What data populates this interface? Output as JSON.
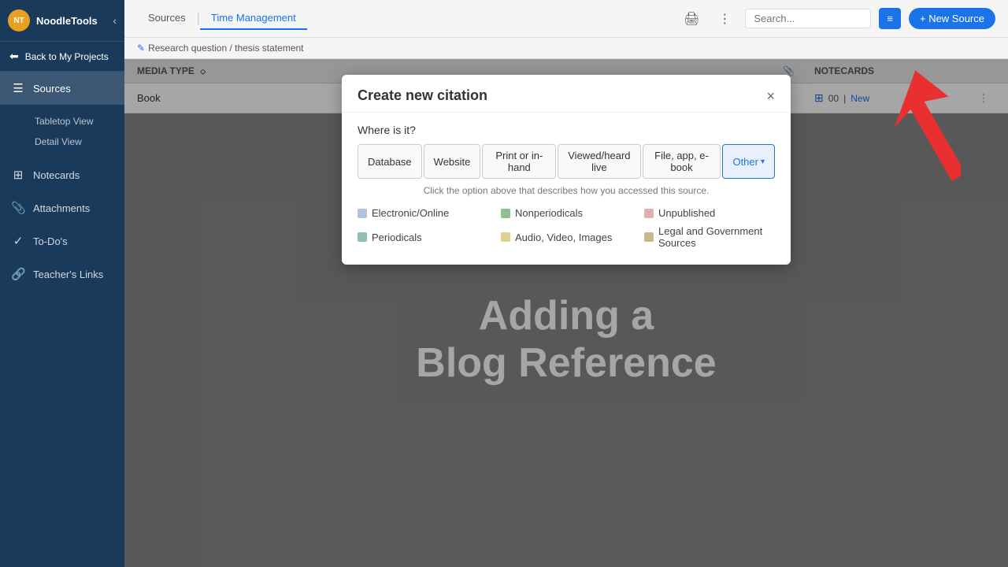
{
  "sidebar": {
    "brand": "NoodleTools",
    "back_label": "Back to My Projects",
    "nav_items": [
      {
        "id": "sources",
        "label": "Sources",
        "icon": "☰",
        "active": true
      },
      {
        "id": "notecards",
        "label": "Notecards",
        "icon": "⊞",
        "active": false
      },
      {
        "id": "attachments",
        "label": "Attachments",
        "icon": "📎",
        "active": false
      },
      {
        "id": "todos",
        "label": "To-Do's",
        "icon": "✓",
        "active": false
      },
      {
        "id": "teacher-links",
        "label": "Teacher's Links",
        "icon": "🔗",
        "active": false
      }
    ],
    "subnav": [
      {
        "label": "Tabletop View"
      },
      {
        "label": "Detail View"
      }
    ]
  },
  "topbar": {
    "tabs": [
      {
        "label": "Sources",
        "active": false
      },
      {
        "label": "Time Management",
        "active": true
      }
    ],
    "search_placeholder": "Search...",
    "filter_icon": "≡",
    "new_source_label": "+ New Source"
  },
  "breadcrumb": {
    "icon": "✎",
    "text": "Research question / thesis statement"
  },
  "table": {
    "columns": {
      "media_type": "MEDIA TYPE",
      "notecards": "NOTECARDS",
      "attach_icon": "📎"
    },
    "rows": [
      {
        "media_type": "Book",
        "notecard_count": "00",
        "notecard_new": "New"
      }
    ]
  },
  "video": {
    "line1": "Adding a",
    "line2": "Blog Reference"
  },
  "modal": {
    "title": "Create new citation",
    "close_label": "×",
    "where_label": "Where is it?",
    "hint": "Click the option above that describes how you accessed this source.",
    "tabs": [
      {
        "label": "Database"
      },
      {
        "label": "Website"
      },
      {
        "label": "Print or in-hand"
      },
      {
        "label": "Viewed/heard live"
      },
      {
        "label": "File, app, e-book"
      },
      {
        "label": "Other",
        "has_arrow": true,
        "active": true
      }
    ],
    "categories": [
      {
        "label": "Electronic/Online",
        "dot": "blue"
      },
      {
        "label": "Nonperiodicals",
        "dot": "green"
      },
      {
        "label": "Unpublished",
        "dot": "pink"
      },
      {
        "label": "Periodicals",
        "dot": "teal"
      },
      {
        "label": "Audio, Video, Images",
        "dot": "yellow"
      },
      {
        "label": "Legal and Government Sources",
        "dot": "tan"
      }
    ]
  }
}
